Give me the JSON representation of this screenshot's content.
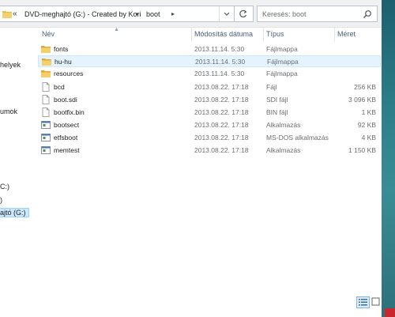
{
  "address": {
    "overflow_label": "«",
    "crumbs": [
      "DVD-meghajtó (G:) - Created by Kori",
      "boot"
    ],
    "separator": "▸"
  },
  "search": {
    "placeholder": "Keresés: boot"
  },
  "nav": {
    "items": [
      {
        "label": "helyek"
      },
      {
        "label": "umok"
      },
      {
        "label": "C:)"
      },
      {
        "label": ")"
      },
      {
        "label": "ajtó (G:)"
      }
    ]
  },
  "columns": {
    "name": "Név",
    "date": "Módosítás dátuma",
    "type": "Típus",
    "size": "Méret"
  },
  "files": [
    {
      "name": "fonts",
      "date": "2013.11.14. 5:30",
      "type": "Fájlmappa",
      "size": "",
      "icon": "folder-icon"
    },
    {
      "name": "hu-hu",
      "date": "2013.11.14. 5:30",
      "type": "Fájlmappa",
      "size": "",
      "icon": "folder-icon"
    },
    {
      "name": "resources",
      "date": "2013.11.14. 5:30",
      "type": "Fájlmappa",
      "size": "",
      "icon": "folder-icon"
    },
    {
      "name": "bcd",
      "date": "2013.08.22. 17:18",
      "type": "Fájl",
      "size": "256 KB",
      "icon": "file-icon"
    },
    {
      "name": "boot.sdi",
      "date": "2013.08.22. 17:18",
      "type": "SDI fájl",
      "size": "3 096 KB",
      "icon": "file-icon"
    },
    {
      "name": "bootfix.bin",
      "date": "2013.08.22. 17:18",
      "type": "BIN fájl",
      "size": "1 KB",
      "icon": "file-icon"
    },
    {
      "name": "bootsect",
      "date": "2013.08.22. 17:18",
      "type": "Alkalmazás",
      "size": "92 KB",
      "icon": "app-icon"
    },
    {
      "name": "etfsboot",
      "date": "2013.08.22. 17:18",
      "type": "MS-DOS alkalmazás",
      "size": "4 KB",
      "icon": "app-icon"
    },
    {
      "name": "memtest",
      "date": "2013.08.22. 17:18",
      "type": "Alkalmazás",
      "size": "1 150 KB",
      "icon": "app-icon"
    }
  ],
  "selected_row": 1,
  "colors": {
    "selection_bg": "#e5f3ff",
    "selection_border": "#cce8ff",
    "folder": "#e8b84a",
    "header_text": "#4c607a"
  }
}
